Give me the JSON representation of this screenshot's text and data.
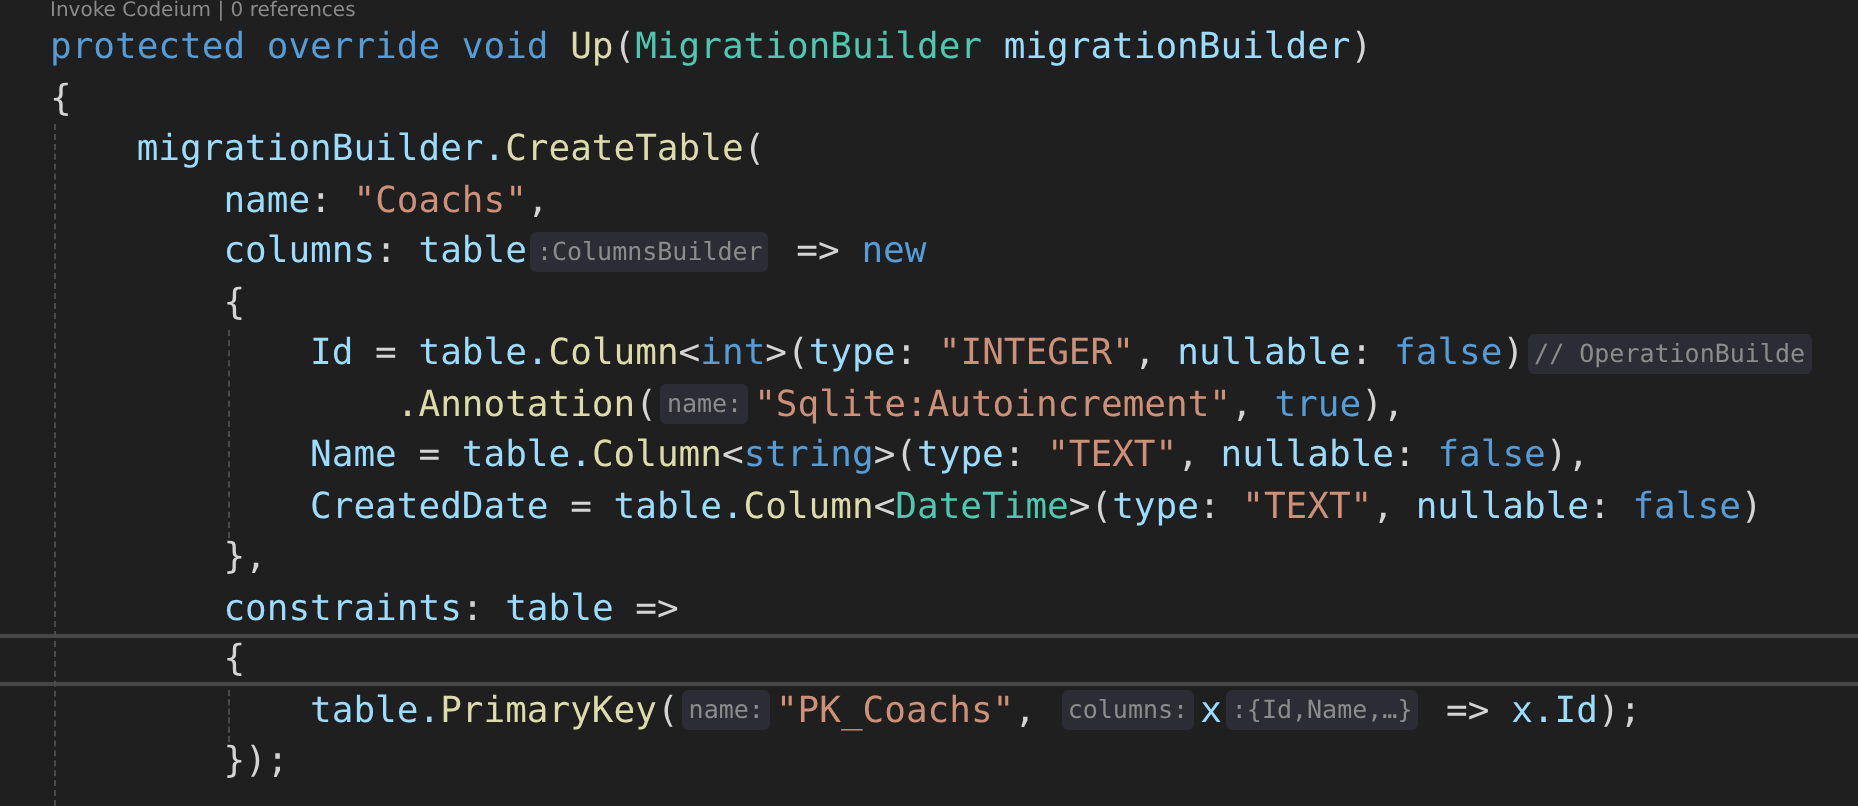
{
  "codelens": "Invoke Codeium | 0 references",
  "lines": [
    {
      "current": false,
      "segments": [
        {
          "kind": "code",
          "tokens": [
            {
              "text": "protected override void ",
              "kind": "kw"
            },
            {
              "text": "Up",
              "kind": "method"
            },
            {
              "text": "(",
              "kind": "plain"
            },
            {
              "text": "MigrationBuilder",
              "kind": "type"
            },
            {
              "text": " migrationBuilder",
              "kind": "var"
            },
            {
              "text": ")",
              "kind": "plain"
            }
          ]
        }
      ]
    },
    {
      "current": false,
      "segments": [
        {
          "kind": "code",
          "tokens": [
            {
              "text": "{",
              "kind": "plain"
            }
          ]
        }
      ]
    },
    {
      "current": false,
      "segments": [
        {
          "kind": "code",
          "tokens": [
            {
              "text": "    migrationBuilder.",
              "kind": "var"
            },
            {
              "text": "CreateTable",
              "kind": "method"
            },
            {
              "text": "(",
              "kind": "plain"
            }
          ]
        }
      ]
    },
    {
      "current": false,
      "segments": [
        {
          "kind": "code",
          "tokens": [
            {
              "text": "        name",
              "kind": "var"
            },
            {
              "text": ": ",
              "kind": "plain"
            },
            {
              "text": "\"Coachs\"",
              "kind": "str"
            },
            {
              "text": ",",
              "kind": "plain"
            }
          ]
        }
      ]
    },
    {
      "current": false,
      "segments": [
        {
          "kind": "code",
          "tokens": [
            {
              "text": "        columns",
              "kind": "var"
            },
            {
              "text": ": ",
              "kind": "plain"
            },
            {
              "text": "table",
              "kind": "var"
            }
          ]
        },
        {
          "kind": "hint",
          "text": ":ColumnsBuilder"
        },
        {
          "kind": "code",
          "tokens": [
            {
              "text": " => ",
              "kind": "plain"
            },
            {
              "text": "new",
              "kind": "kw"
            }
          ]
        }
      ]
    },
    {
      "current": false,
      "segments": [
        {
          "kind": "code",
          "tokens": [
            {
              "text": "        {",
              "kind": "plain"
            }
          ]
        }
      ]
    },
    {
      "current": false,
      "segments": [
        {
          "kind": "code",
          "tokens": [
            {
              "text": "            Id",
              "kind": "var"
            },
            {
              "text": " = ",
              "kind": "plain"
            },
            {
              "text": "table.",
              "kind": "var"
            },
            {
              "text": "Column",
              "kind": "method"
            },
            {
              "text": "<",
              "kind": "plain"
            },
            {
              "text": "int",
              "kind": "kw"
            },
            {
              "text": ">(",
              "kind": "plain"
            },
            {
              "text": "type",
              "kind": "var"
            },
            {
              "text": ": ",
              "kind": "plain"
            },
            {
              "text": "\"INTEGER\"",
              "kind": "str"
            },
            {
              "text": ", ",
              "kind": "plain"
            },
            {
              "text": "nullable",
              "kind": "var"
            },
            {
              "text": ": ",
              "kind": "plain"
            },
            {
              "text": "false",
              "kind": "kw"
            },
            {
              "text": ")",
              "kind": "plain"
            }
          ]
        },
        {
          "kind": "hint",
          "text": "// OperationBuilde"
        }
      ]
    },
    {
      "current": false,
      "segments": [
        {
          "kind": "code",
          "tokens": [
            {
              "text": "                .Annotation",
              "kind": "method"
            },
            {
              "text": "(",
              "kind": "plain"
            }
          ]
        },
        {
          "kind": "hint",
          "text": "name:"
        },
        {
          "kind": "code",
          "tokens": [
            {
              "text": "\"Sqlite:Autoincrement\"",
              "kind": "str"
            },
            {
              "text": ", ",
              "kind": "plain"
            },
            {
              "text": "true",
              "kind": "kw"
            },
            {
              "text": "),",
              "kind": "plain"
            }
          ]
        }
      ]
    },
    {
      "current": false,
      "segments": [
        {
          "kind": "code",
          "tokens": [
            {
              "text": "            Name",
              "kind": "var"
            },
            {
              "text": " = ",
              "kind": "plain"
            },
            {
              "text": "table.",
              "kind": "var"
            },
            {
              "text": "Column",
              "kind": "method"
            },
            {
              "text": "<",
              "kind": "plain"
            },
            {
              "text": "string",
              "kind": "kw"
            },
            {
              "text": ">(",
              "kind": "plain"
            },
            {
              "text": "type",
              "kind": "var"
            },
            {
              "text": ": ",
              "kind": "plain"
            },
            {
              "text": "\"TEXT\"",
              "kind": "str"
            },
            {
              "text": ", ",
              "kind": "plain"
            },
            {
              "text": "nullable",
              "kind": "var"
            },
            {
              "text": ": ",
              "kind": "plain"
            },
            {
              "text": "false",
              "kind": "kw"
            },
            {
              "text": "),",
              "kind": "plain"
            }
          ]
        }
      ]
    },
    {
      "current": false,
      "segments": [
        {
          "kind": "code",
          "tokens": [
            {
              "text": "            CreatedDate",
              "kind": "var"
            },
            {
              "text": " = ",
              "kind": "plain"
            },
            {
              "text": "table.",
              "kind": "var"
            },
            {
              "text": "Column",
              "kind": "method"
            },
            {
              "text": "<",
              "kind": "plain"
            },
            {
              "text": "DateTime",
              "kind": "type"
            },
            {
              "text": ">(",
              "kind": "plain"
            },
            {
              "text": "type",
              "kind": "var"
            },
            {
              "text": ": ",
              "kind": "plain"
            },
            {
              "text": "\"TEXT\"",
              "kind": "str"
            },
            {
              "text": ", ",
              "kind": "plain"
            },
            {
              "text": "nullable",
              "kind": "var"
            },
            {
              "text": ": ",
              "kind": "plain"
            },
            {
              "text": "false",
              "kind": "kw"
            },
            {
              "text": ")",
              "kind": "plain"
            }
          ]
        }
      ]
    },
    {
      "current": false,
      "segments": [
        {
          "kind": "code",
          "tokens": [
            {
              "text": "        },",
              "kind": "plain"
            }
          ]
        }
      ]
    },
    {
      "current": false,
      "segments": [
        {
          "kind": "code",
          "tokens": [
            {
              "text": "        constraints",
              "kind": "var"
            },
            {
              "text": ": ",
              "kind": "plain"
            },
            {
              "text": "table",
              "kind": "var"
            },
            {
              "text": " =>",
              "kind": "plain"
            }
          ]
        }
      ]
    },
    {
      "current": true,
      "segments": [
        {
          "kind": "code",
          "tokens": [
            {
              "text": "        {",
              "kind": "plain"
            }
          ]
        }
      ]
    },
    {
      "current": false,
      "segments": [
        {
          "kind": "code",
          "tokens": [
            {
              "text": "            table.",
              "kind": "var"
            },
            {
              "text": "PrimaryKey",
              "kind": "method"
            },
            {
              "text": "(",
              "kind": "plain"
            }
          ]
        },
        {
          "kind": "hint",
          "text": "name:"
        },
        {
          "kind": "code",
          "tokens": [
            {
              "text": "\"PK_Coachs\"",
              "kind": "str"
            },
            {
              "text": ", ",
              "kind": "plain"
            }
          ]
        },
        {
          "kind": "hint",
          "text": "columns:"
        },
        {
          "kind": "code",
          "tokens": [
            {
              "text": "x",
              "kind": "var"
            }
          ]
        },
        {
          "kind": "hint",
          "text": ":{Id,Name,…}"
        },
        {
          "kind": "code",
          "tokens": [
            {
              "text": " => ",
              "kind": "plain"
            },
            {
              "text": "x.Id",
              "kind": "var"
            },
            {
              "text": ");",
              "kind": "plain"
            }
          ]
        }
      ]
    },
    {
      "current": false,
      "segments": [
        {
          "kind": "code",
          "tokens": [
            {
              "text": "        });",
              "kind": "plain"
            }
          ]
        }
      ]
    }
  ]
}
